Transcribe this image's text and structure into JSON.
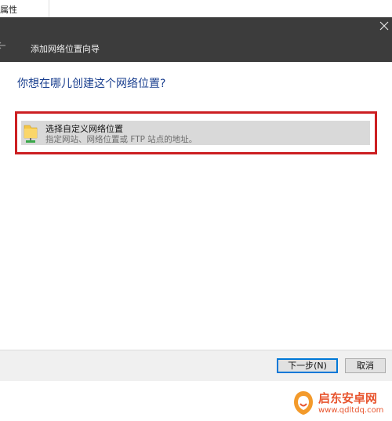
{
  "background_window": {
    "title_fragment": "属性"
  },
  "wizard": {
    "title": "添加网络位置向导",
    "question": "你想在哪儿创建这个网络位置?",
    "option": {
      "title": "选择自定义网络位置",
      "description": "指定网站、网络位置或 FTP 站点的地址。"
    },
    "buttons": {
      "next": "下一步(N)",
      "cancel": "取消"
    }
  },
  "watermark": {
    "name": "启东安卓网",
    "url": "www.qdltdq.com"
  },
  "colors": {
    "header_bg": "#3c3c3c",
    "question_text": "#1a3f8f",
    "highlight_border": "#cc1f22",
    "selected_option_bg": "#d9d9d9",
    "watermark": "#e8552f"
  }
}
